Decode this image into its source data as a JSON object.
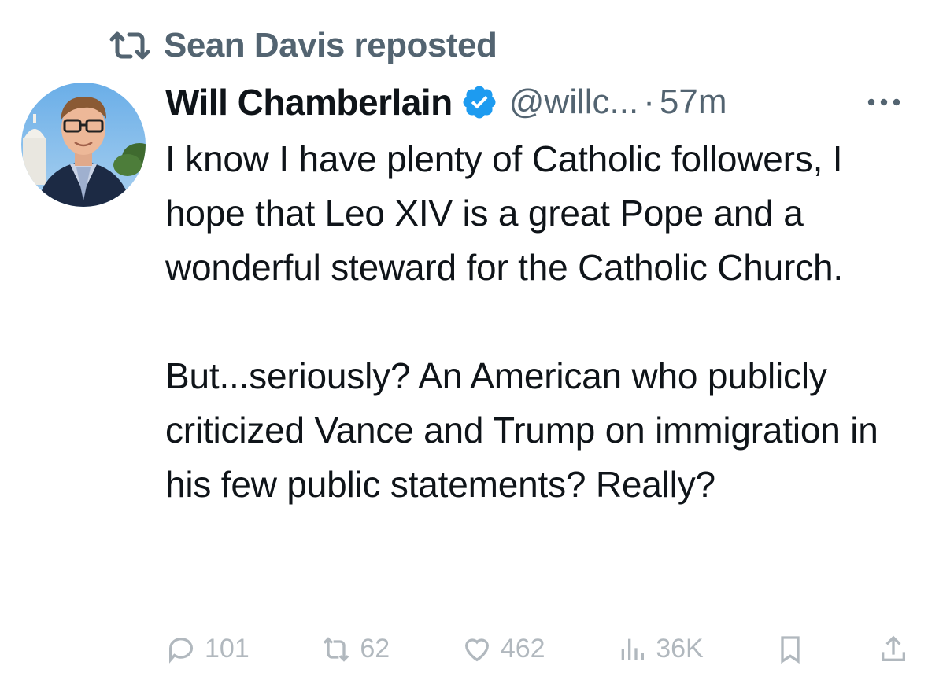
{
  "repost": {
    "icon": "repost-icon",
    "label": "Sean Davis reposted"
  },
  "author": {
    "avatar_icon": "avatar",
    "display_name": "Will Chamberlain",
    "verified_icon": "verified-badge-icon",
    "handle": "@willc...",
    "separator": "·",
    "timestamp": "57m",
    "more_icon": "more-options-icon"
  },
  "tweet": {
    "text": "I know I have plenty of Catholic followers, I hope that Leo XIV is a great Pope and a wonderful steward for the Catholic Church.\n\nBut...seriously? An American who publicly criticized Vance and Trump on immigration in his few public statements? Really?"
  },
  "actions": {
    "reply_icon": "reply-icon",
    "reply_count": "101",
    "retweet_icon": "retweet-icon",
    "retweet_count": "62",
    "like_icon": "like-icon",
    "like_count": "462",
    "views_icon": "views-icon",
    "views_count": "36K",
    "bookmark_icon": "bookmark-icon",
    "share_icon": "share-icon"
  },
  "colors": {
    "text_primary": "#0f1419",
    "text_secondary": "#536471",
    "verified_blue": "#1d9bf0"
  }
}
